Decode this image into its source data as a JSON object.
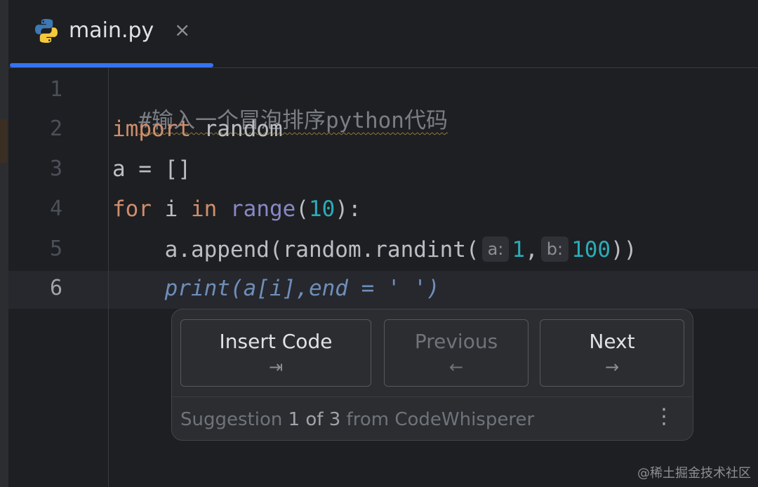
{
  "tab": {
    "filename": "main.py",
    "close_glyph": "×",
    "icon": "python-icon"
  },
  "editor": {
    "line_numbers": [
      "1",
      "2",
      "3",
      "4",
      "5",
      "6"
    ],
    "active_line": "6",
    "lines": {
      "l1_comment": "#输入一个冒泡排序python代码",
      "l2_kw": "import",
      "l2_rest": " random",
      "l3": "a = []",
      "l4_kw_for": "for",
      "l4_i": " i ",
      "l4_kw_in": "in",
      "l4_sp": " ",
      "l4_range": "range",
      "l4_open": "(",
      "l4_num": "10",
      "l4_close": "):",
      "l5_indent": "    ",
      "l5_pre": "a.append(random.randint(",
      "l5_hint_a": "a:",
      "l5_num1": "1",
      "l5_comma": ",",
      "l5_hint_b": "b:",
      "l5_num2": "100",
      "l5_close": "))",
      "l6_indent": "    ",
      "l6_ghost": "print(a[i],end = ' ')"
    }
  },
  "suggestion_popup": {
    "insert_label": "Insert Code",
    "insert_key": "⇥",
    "previous_label": "Previous",
    "previous_key": "←",
    "next_label": "Next",
    "next_key": "→",
    "footer_prefix": "Suggestion ",
    "footer_index": "1 of 3",
    "footer_suffix": " from CodeWhisperer",
    "more_glyph": "⋮"
  },
  "watermark": "@稀土掘金技术社区",
  "colors": {
    "background": "#1e1f22",
    "accent": "#3574f0",
    "keyword": "#cf8e6d",
    "number": "#2aacb8",
    "builtin": "#8888c6",
    "ghost_text": "#6f8eb8"
  }
}
